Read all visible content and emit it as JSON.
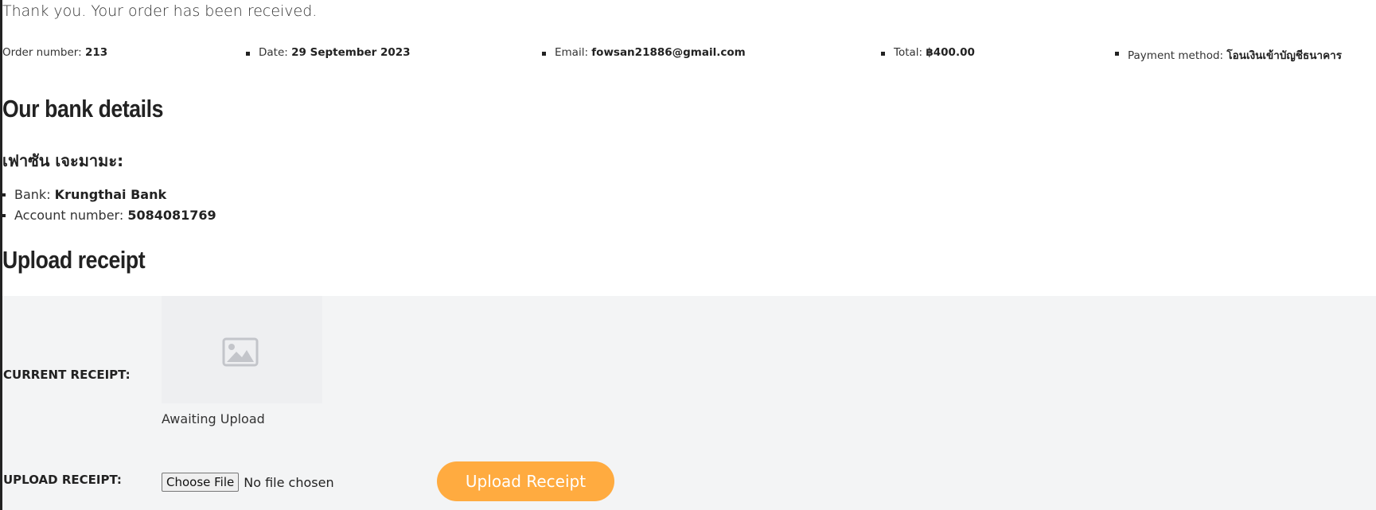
{
  "thank_you": "Thank you. Your order has been received.",
  "order_overview": [
    {
      "label": "Order number: ",
      "value": "213"
    },
    {
      "label": "Date: ",
      "value": "29 September 2023"
    },
    {
      "label": "Email: ",
      "value": "fowsan21886@gmail.com"
    },
    {
      "label": "Total: ",
      "value": "฿400.00"
    },
    {
      "label": "Payment method: ",
      "value": "โอนเงินเข้าบัญชีธนาคาร"
    }
  ],
  "bank_details": {
    "heading": "Our bank details",
    "account_name": "เฟาซัน เจะมามะ:",
    "items": [
      {
        "label": "Bank: ",
        "value": "Krungthai Bank"
      },
      {
        "label": "Account number: ",
        "value": "5084081769"
      }
    ]
  },
  "upload_section": {
    "heading": "Upload receipt",
    "current_receipt_label": "CURRENT RECEIPT:",
    "receipt_status": "Awaiting Upload",
    "upload_receipt_label": "UPLOAD RECEIPT:",
    "file_button": "Choose File",
    "file_status": "No file chosen",
    "upload_button": "Upload Receipt",
    "icon": "image-placeholder-icon",
    "accent_color": "#ffab40"
  }
}
